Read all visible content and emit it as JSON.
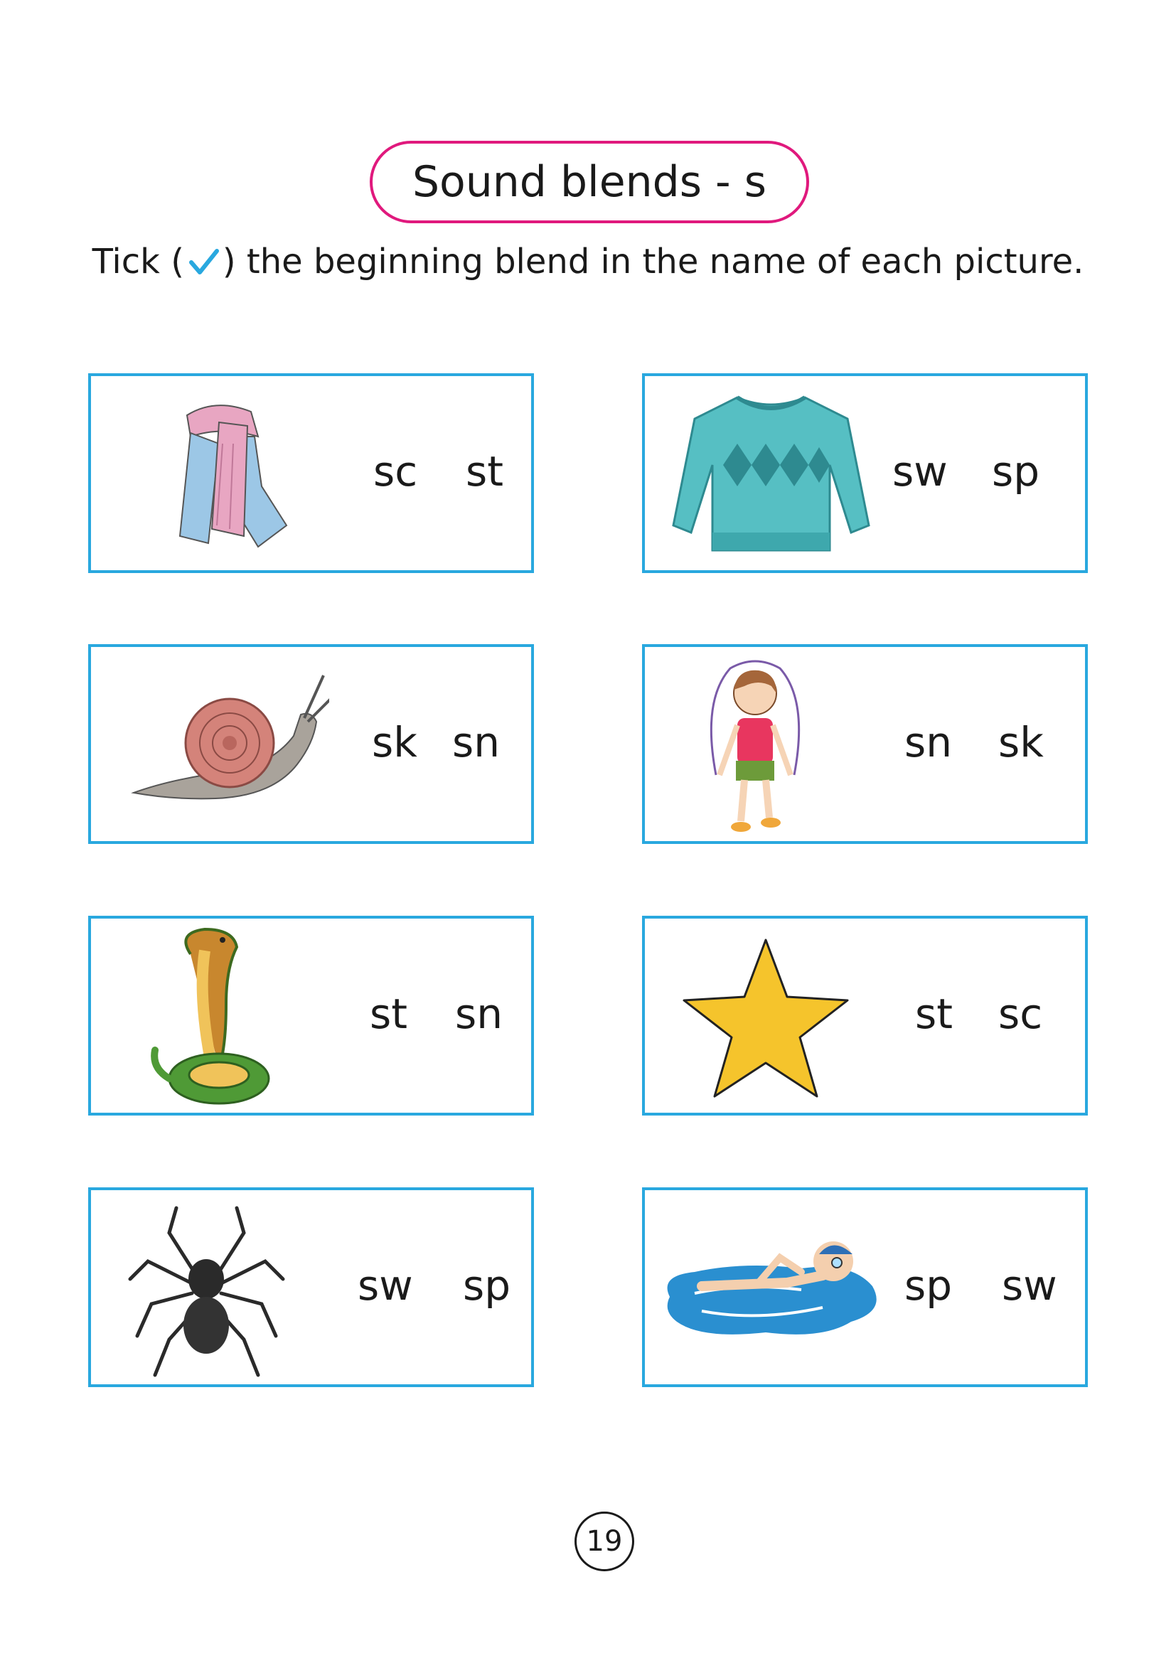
{
  "title": "Sound blends - s",
  "instruction": {
    "before": "Tick (",
    "after": ") the beginning blend in the name of each picture."
  },
  "cards": [
    {
      "picture": "scarf",
      "options": [
        "sc",
        "st"
      ]
    },
    {
      "picture": "sweater",
      "options": [
        "sw",
        "sp"
      ]
    },
    {
      "picture": "snail",
      "options": [
        "sk",
        "sn"
      ]
    },
    {
      "picture": "skipping-girl",
      "options": [
        "sn",
        "sk"
      ]
    },
    {
      "picture": "snake",
      "options": [
        "st",
        "sn"
      ]
    },
    {
      "picture": "star",
      "options": [
        "st",
        "sc"
      ]
    },
    {
      "picture": "spider",
      "options": [
        "sw",
        "sp"
      ]
    },
    {
      "picture": "swimmer",
      "options": [
        "sp",
        "sw"
      ]
    }
  ],
  "page_number": "19",
  "colors": {
    "title_border": "#e0197d",
    "card_border": "#29a8df",
    "tick": "#29a8df"
  }
}
